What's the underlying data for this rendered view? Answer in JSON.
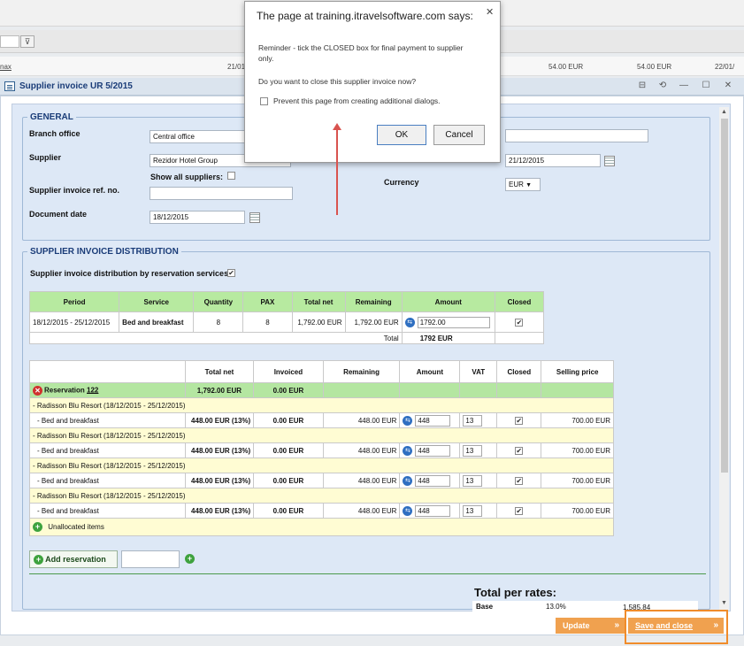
{
  "background": {
    "filter_text": "",
    "row_cells": [
      "nax",
      "21/01",
      "54.00 EUR",
      "54.00 EUR",
      "22/01/"
    ]
  },
  "window": {
    "title": "Supplier invoice UR 5/2015"
  },
  "general": {
    "legend": "GENERAL",
    "branch_label": "Branch office",
    "branch_value": "Central office",
    "supplier_label": "Supplier",
    "supplier_value": "Rezidor Hotel Group",
    "show_all_label": "Show all suppliers:",
    "ref_label": "Supplier invoice ref. no.",
    "ref_value": "",
    "docdate_label": "Document date",
    "docdate_value": "18/12/2015",
    "right_field_value": "",
    "right_date_value": "21/12/2015",
    "currency_label": "Currency",
    "currency_value": "EUR"
  },
  "distribution": {
    "legend": "SUPPLIER INVOICE DISTRIBUTION",
    "by_services_label": "Supplier invoice distribution by reservation services",
    "table1": {
      "headers": [
        "Period",
        "Service",
        "Quantity",
        "PAX",
        "Total net",
        "Remaining",
        "Amount",
        "Closed"
      ],
      "row": {
        "period": "18/12/2015 - 25/12/2015",
        "service": "Bed and breakfast",
        "quantity": "8",
        "pax": "8",
        "total_net": "1,792.00 EUR",
        "remaining": "1,792.00 EUR",
        "amount": "1792.00"
      },
      "total_label": "Total",
      "total_value": "1792 EUR"
    },
    "table2": {
      "headers": [
        "Total net",
        "Invoiced",
        "Remaining",
        "Amount",
        "VAT",
        "Closed",
        "Selling price"
      ],
      "reservation_label": "Reservation",
      "reservation_no": "122",
      "reservation_total_net": "1,792.00 EUR",
      "reservation_invoiced": "0.00 EUR",
      "groups": [
        {
          "hotel": "- Radisson Blu Resort (18/12/2015 - 25/12/2015)",
          "item": "- Bed and breakfast",
          "total_net": "448.00 EUR (13%)",
          "invoiced": "0.00 EUR",
          "remaining": "448.00 EUR",
          "amount": "448",
          "vat": "13",
          "selling": "700.00 EUR"
        },
        {
          "hotel": "- Radisson Blu Resort (18/12/2015 - 25/12/2015)",
          "item": "- Bed and breakfast",
          "total_net": "448.00 EUR (13%)",
          "invoiced": "0.00 EUR",
          "remaining": "448.00 EUR",
          "amount": "448",
          "vat": "13",
          "selling": "700.00 EUR"
        },
        {
          "hotel": "- Radisson Blu Resort (18/12/2015 - 25/12/2015)",
          "item": "- Bed and breakfast",
          "total_net": "448.00 EUR (13%)",
          "invoiced": "0.00 EUR",
          "remaining": "448.00 EUR",
          "amount": "448",
          "vat": "13",
          "selling": "700.00 EUR"
        },
        {
          "hotel": "- Radisson Blu Resort (18/12/2015 - 25/12/2015)",
          "item": "- Bed and breakfast",
          "total_net": "448.00 EUR (13%)",
          "invoiced": "0.00 EUR",
          "remaining": "448.00 EUR",
          "amount": "448",
          "vat": "13",
          "selling": "700.00 EUR"
        }
      ],
      "unallocated_label": "Unallocated items"
    },
    "add_reservation_label": "Add reservation",
    "add_reservation_input": ""
  },
  "rates": {
    "title": "Total per rates:",
    "row_label": "Base",
    "row_pct": "13.0%",
    "row_value": "1,585.84"
  },
  "actions": {
    "update_label": "Update",
    "save_close_label": "Save and close"
  },
  "dialog": {
    "title": "The page at training.itravelsoftware.com says:",
    "line1": "Reminder - tick the CLOSED box for final payment to supplier only.",
    "line2": "Do you want to close this supplier invoice now?",
    "prevent_label": "Prevent this page from creating additional dialogs.",
    "ok_label": "OK",
    "cancel_label": "Cancel"
  },
  "colors": {
    "accent": "#1a3c78",
    "header_green": "#b7eaa0",
    "hotel_row": "#fffcd3",
    "action_orange": "#f0a14f",
    "highlight": "#f08c2b",
    "annotation_arrow": "#d9534f"
  }
}
